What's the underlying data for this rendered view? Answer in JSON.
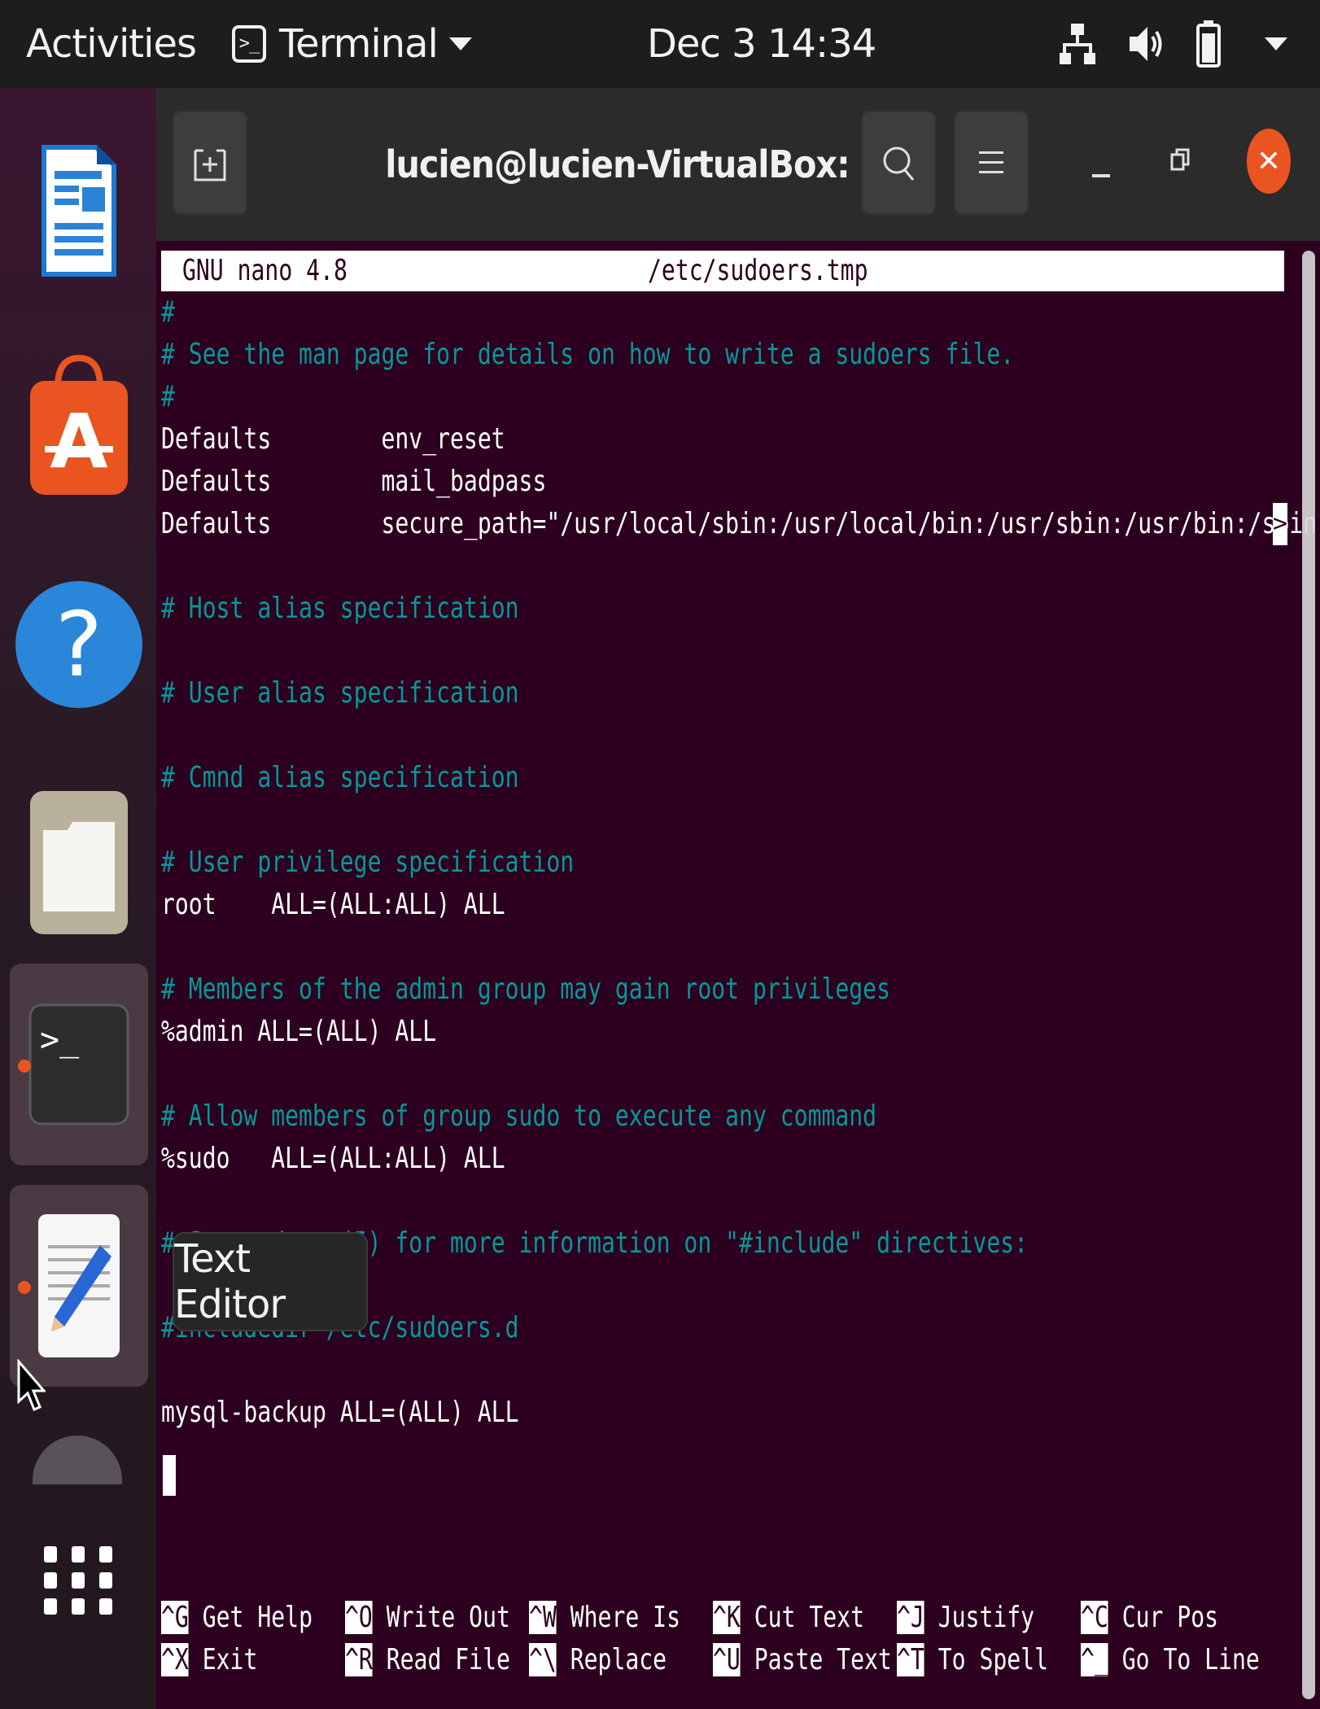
{
  "topbar": {
    "activities": "Activities",
    "app_name": "Terminal",
    "clock": "Dec 3  14:34"
  },
  "dock": {
    "tooltip": "Text Editor",
    "items": [
      "libreoffice-writer",
      "ubuntu-software",
      "help",
      "files",
      "terminal",
      "text-editor",
      "trash",
      "show-applications"
    ]
  },
  "window": {
    "title": "lucien@lucien-VirtualBox: ~"
  },
  "nano": {
    "version": "GNU nano 4.8",
    "filename": "/etc/sudoers.tmp",
    "lines": [
      "#",
      "# See the man page for details on how to write a sudoers file.",
      "#",
      "Defaults        env_reset",
      "Defaults        mail_badpass",
      "Defaults        secure_path=\"/usr/local/sbin:/usr/local/bin:/usr/sbin:/usr/bin:/sbin:",
      "",
      "# Host alias specification",
      "",
      "# User alias specification",
      "",
      "# Cmnd alias specification",
      "",
      "# User privilege specification",
      "root    ALL=(ALL:ALL) ALL",
      "",
      "# Members of the admin group may gain root privileges",
      "%admin ALL=(ALL) ALL",
      "",
      "# Allow members of group sudo to execute any command",
      "%sudo   ALL=(ALL:ALL) ALL",
      "",
      "# See sudoers(5) for more information on \"#include\" directives:",
      "",
      "#includedir /etc/sudoers.d",
      "",
      "mysql-backup ALL=(ALL) ALL"
    ],
    "more_marker": ">",
    "shortcuts_row1": [
      {
        "key": "^G",
        "label": "Get Help"
      },
      {
        "key": "^O",
        "label": "Write Out"
      },
      {
        "key": "^W",
        "label": "Where Is"
      },
      {
        "key": "^K",
        "label": "Cut Text"
      },
      {
        "key": "^J",
        "label": "Justify"
      },
      {
        "key": "^C",
        "label": "Cur Pos"
      }
    ],
    "shortcuts_row2": [
      {
        "key": "^X",
        "label": "Exit"
      },
      {
        "key": "^R",
        "label": "Read File"
      },
      {
        "key": "^\\",
        "label": "Replace"
      },
      {
        "key": "^U",
        "label": "Paste Text"
      },
      {
        "key": "^T",
        "label": "To Spell"
      },
      {
        "key": "^_",
        "label": "Go To Line"
      }
    ]
  },
  "colors": {
    "terminal_bg": "#2c001e",
    "comment": "#06989a",
    "accent": "#e95420"
  }
}
